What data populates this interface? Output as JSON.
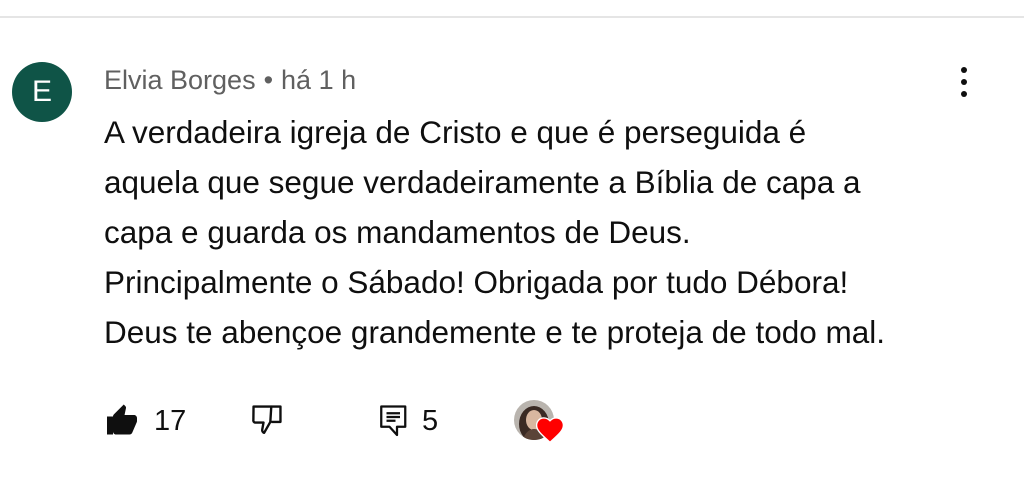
{
  "comment": {
    "author_initial": "E",
    "author_name": "Elvia Borges",
    "separator": "•",
    "time_ago": "há 1 h",
    "text_lines": [
      "A verdadeira igreja de Cristo e que é perseguida é",
      "aquela que segue verdadeiramente a Bíblia de capa a",
      "capa e guarda os mandamentos de Deus.",
      "Principalmente o Sábado! Obrigada por tudo Débora!",
      "Deus te abençoe grandemente e te proteja de todo mal."
    ],
    "avatar_color": "#0f5447"
  },
  "actions": {
    "like_count": "17",
    "reply_count": "5",
    "like_icon": "thumbs-up-filled-icon",
    "dislike_icon": "thumbs-down-outline-icon",
    "reply_icon": "reply-comment-icon",
    "creator_heart_icon": "creator-heart-icon",
    "heart_color": "#ff0000"
  },
  "menu": {
    "icon": "more-vertical-icon"
  }
}
